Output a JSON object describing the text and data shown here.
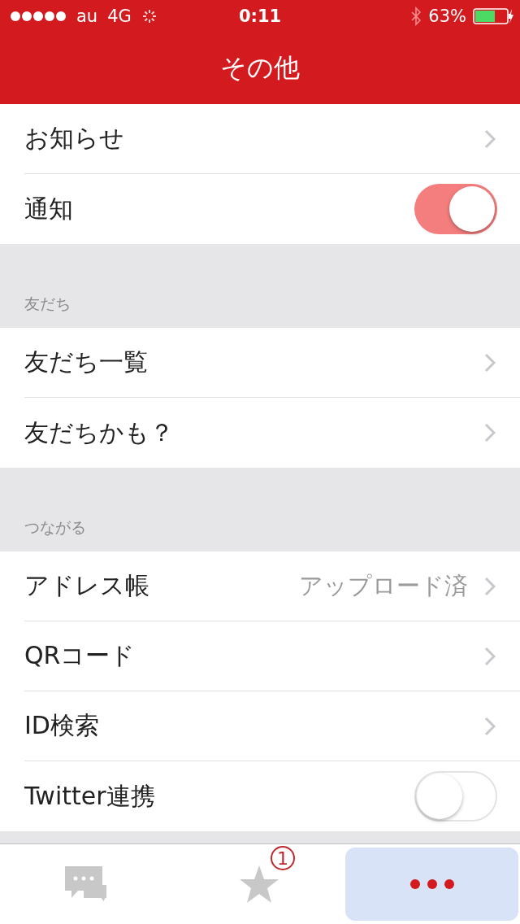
{
  "status_bar": {
    "carrier": "au",
    "network": "4G",
    "time": "0:11",
    "battery": "63%"
  },
  "nav": {
    "title": "その他"
  },
  "sections": [
    {
      "rows": [
        {
          "label": "お知らせ",
          "kind": "chevron"
        },
        {
          "label": "通知",
          "kind": "toggle",
          "on": true
        }
      ]
    },
    {
      "header": "友だち",
      "rows": [
        {
          "label": "友だち一覧",
          "kind": "chevron"
        },
        {
          "label": "友だちかも？",
          "kind": "chevron"
        }
      ]
    },
    {
      "header": "つながる",
      "rows": [
        {
          "label": "アドレス帳",
          "kind": "chevron",
          "value": "アップロード済"
        },
        {
          "label": "QRコード",
          "kind": "chevron"
        },
        {
          "label": "ID検索",
          "kind": "chevron"
        },
        {
          "label": "Twitter連携",
          "kind": "toggle",
          "on": false
        }
      ]
    }
  ],
  "tabs": [
    {
      "kind": "chat",
      "selected": false
    },
    {
      "kind": "star",
      "badge": "1",
      "selected": false
    },
    {
      "kind": "more",
      "selected": true
    }
  ]
}
